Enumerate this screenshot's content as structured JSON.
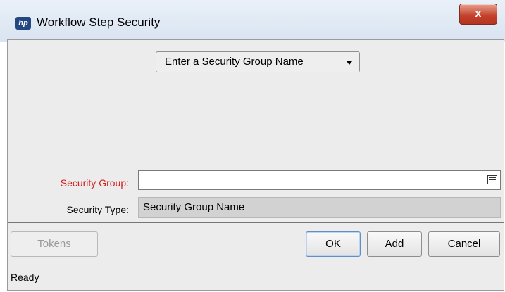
{
  "window": {
    "title": "Workflow Step Security",
    "app_icon": "hp-logo-icon",
    "close_label": "x"
  },
  "selector": {
    "value": "Enter a Security Group Name"
  },
  "form": {
    "security_group_label": "Security Group:",
    "security_group_value": "",
    "security_type_label": "Security Type:",
    "security_type_value": "Security Group Name"
  },
  "buttons": {
    "tokens": "Tokens",
    "ok": "OK",
    "add": "Add",
    "cancel": "Cancel"
  },
  "status": {
    "text": "Ready"
  },
  "colors": {
    "required_label": "#d51c1c",
    "close_button": "#c3402a",
    "title_bar": "#dfe8f3"
  }
}
